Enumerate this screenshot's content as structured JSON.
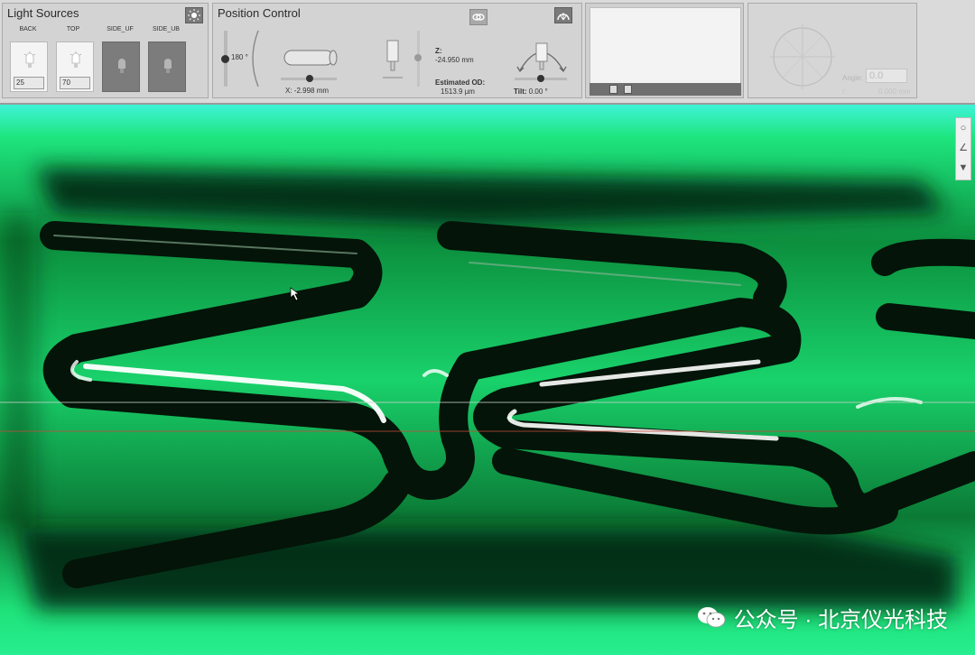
{
  "light_sources": {
    "title": "Light Sources",
    "channels": [
      {
        "label": "BACK",
        "value": "25",
        "state": "on"
      },
      {
        "label": "TOP",
        "value": "70",
        "state": "on"
      },
      {
        "label": "SIDE_UF",
        "value": "",
        "state": "off"
      },
      {
        "label": "SIDE_UB",
        "value": "",
        "state": "off"
      }
    ]
  },
  "position_control": {
    "title": "Position Control",
    "rotation_value": "180 °",
    "x_label": "X:",
    "x_value": "-2.998 mm",
    "z_label": "Z:",
    "z_value": "-24.950 mm",
    "od_label": "Estimated OD:",
    "od_value": "1513.9 µm",
    "tilt_label": "Tilt:",
    "tilt_value": "0.00 °"
  },
  "angle_panel": {
    "angle_label": "Angle:",
    "angle_value": "0.0",
    "r_label": "r:",
    "r_value": "0.000 mm"
  },
  "watermark": {
    "text": "公众号 · 北京仪光科技"
  },
  "colors": {
    "toolbar_bg": "#dadada",
    "panel_bg": "#d3d3d3",
    "viewer_green": "#1fe27a",
    "viewer_cyan": "#2ff2d4",
    "stent_dark": "#041408",
    "stent_highlight": "#ffffff"
  },
  "icons": [
    "sun-icon",
    "link-icon",
    "arc-icon",
    "bulb-icon",
    "document-icon",
    "trash-icon",
    "circle-tool-icon",
    "angle-tool-icon",
    "eraser-icon",
    "cursor-icon",
    "wechat-icon"
  ]
}
